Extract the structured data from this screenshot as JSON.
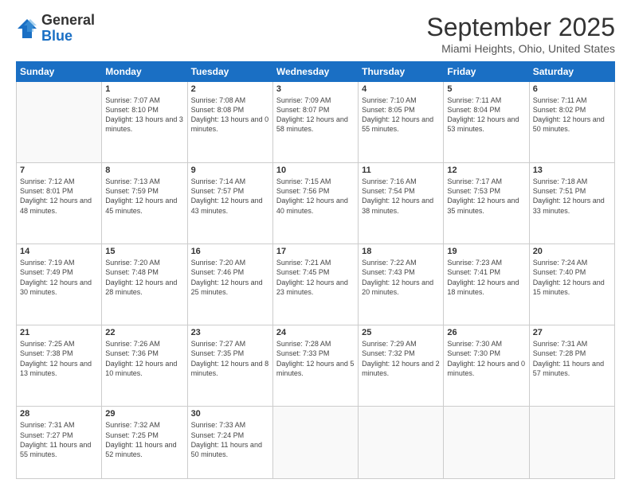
{
  "header": {
    "logo": {
      "line1": "General",
      "line2": "Blue"
    },
    "title": "September 2025",
    "location": "Miami Heights, Ohio, United States"
  },
  "weekdays": [
    "Sunday",
    "Monday",
    "Tuesday",
    "Wednesday",
    "Thursday",
    "Friday",
    "Saturday"
  ],
  "weeks": [
    [
      null,
      {
        "day": 1,
        "sunrise": "7:07 AM",
        "sunset": "8:10 PM",
        "daylight": "13 hours and 3 minutes."
      },
      {
        "day": 2,
        "sunrise": "7:08 AM",
        "sunset": "8:08 PM",
        "daylight": "13 hours and 0 minutes."
      },
      {
        "day": 3,
        "sunrise": "7:09 AM",
        "sunset": "8:07 PM",
        "daylight": "12 hours and 58 minutes."
      },
      {
        "day": 4,
        "sunrise": "7:10 AM",
        "sunset": "8:05 PM",
        "daylight": "12 hours and 55 minutes."
      },
      {
        "day": 5,
        "sunrise": "7:11 AM",
        "sunset": "8:04 PM",
        "daylight": "12 hours and 53 minutes."
      },
      {
        "day": 6,
        "sunrise": "7:11 AM",
        "sunset": "8:02 PM",
        "daylight": "12 hours and 50 minutes."
      }
    ],
    [
      {
        "day": 7,
        "sunrise": "7:12 AM",
        "sunset": "8:01 PM",
        "daylight": "12 hours and 48 minutes."
      },
      {
        "day": 8,
        "sunrise": "7:13 AM",
        "sunset": "7:59 PM",
        "daylight": "12 hours and 45 minutes."
      },
      {
        "day": 9,
        "sunrise": "7:14 AM",
        "sunset": "7:57 PM",
        "daylight": "12 hours and 43 minutes."
      },
      {
        "day": 10,
        "sunrise": "7:15 AM",
        "sunset": "7:56 PM",
        "daylight": "12 hours and 40 minutes."
      },
      {
        "day": 11,
        "sunrise": "7:16 AM",
        "sunset": "7:54 PM",
        "daylight": "12 hours and 38 minutes."
      },
      {
        "day": 12,
        "sunrise": "7:17 AM",
        "sunset": "7:53 PM",
        "daylight": "12 hours and 35 minutes."
      },
      {
        "day": 13,
        "sunrise": "7:18 AM",
        "sunset": "7:51 PM",
        "daylight": "12 hours and 33 minutes."
      }
    ],
    [
      {
        "day": 14,
        "sunrise": "7:19 AM",
        "sunset": "7:49 PM",
        "daylight": "12 hours and 30 minutes."
      },
      {
        "day": 15,
        "sunrise": "7:20 AM",
        "sunset": "7:48 PM",
        "daylight": "12 hours and 28 minutes."
      },
      {
        "day": 16,
        "sunrise": "7:20 AM",
        "sunset": "7:46 PM",
        "daylight": "12 hours and 25 minutes."
      },
      {
        "day": 17,
        "sunrise": "7:21 AM",
        "sunset": "7:45 PM",
        "daylight": "12 hours and 23 minutes."
      },
      {
        "day": 18,
        "sunrise": "7:22 AM",
        "sunset": "7:43 PM",
        "daylight": "12 hours and 20 minutes."
      },
      {
        "day": 19,
        "sunrise": "7:23 AM",
        "sunset": "7:41 PM",
        "daylight": "12 hours and 18 minutes."
      },
      {
        "day": 20,
        "sunrise": "7:24 AM",
        "sunset": "7:40 PM",
        "daylight": "12 hours and 15 minutes."
      }
    ],
    [
      {
        "day": 21,
        "sunrise": "7:25 AM",
        "sunset": "7:38 PM",
        "daylight": "12 hours and 13 minutes."
      },
      {
        "day": 22,
        "sunrise": "7:26 AM",
        "sunset": "7:36 PM",
        "daylight": "12 hours and 10 minutes."
      },
      {
        "day": 23,
        "sunrise": "7:27 AM",
        "sunset": "7:35 PM",
        "daylight": "12 hours and 8 minutes."
      },
      {
        "day": 24,
        "sunrise": "7:28 AM",
        "sunset": "7:33 PM",
        "daylight": "12 hours and 5 minutes."
      },
      {
        "day": 25,
        "sunrise": "7:29 AM",
        "sunset": "7:32 PM",
        "daylight": "12 hours and 2 minutes."
      },
      {
        "day": 26,
        "sunrise": "7:30 AM",
        "sunset": "7:30 PM",
        "daylight": "12 hours and 0 minutes."
      },
      {
        "day": 27,
        "sunrise": "7:31 AM",
        "sunset": "7:28 PM",
        "daylight": "11 hours and 57 minutes."
      }
    ],
    [
      {
        "day": 28,
        "sunrise": "7:31 AM",
        "sunset": "7:27 PM",
        "daylight": "11 hours and 55 minutes."
      },
      {
        "day": 29,
        "sunrise": "7:32 AM",
        "sunset": "7:25 PM",
        "daylight": "11 hours and 52 minutes."
      },
      {
        "day": 30,
        "sunrise": "7:33 AM",
        "sunset": "7:24 PM",
        "daylight": "11 hours and 50 minutes."
      },
      null,
      null,
      null,
      null
    ]
  ]
}
